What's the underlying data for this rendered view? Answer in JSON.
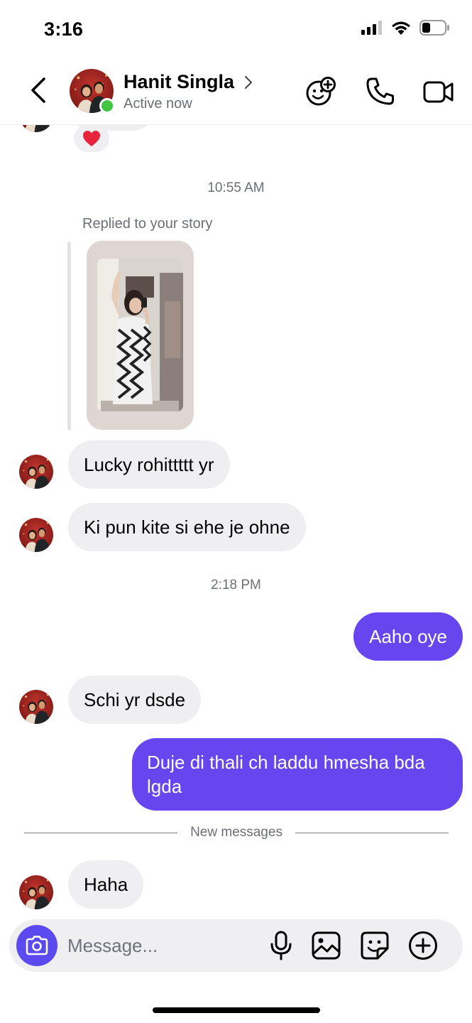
{
  "status_bar": {
    "time": "3:16",
    "icons": [
      "cellular-signal-icon",
      "wifi-icon",
      "battery-icon"
    ]
  },
  "header": {
    "contact_name": "Hanit Singla",
    "contact_status": "Active now",
    "icons": [
      "back-icon",
      "chevron-right-icon",
      "add-effect-icon",
      "phone-icon",
      "video-camera-icon"
    ]
  },
  "thread": {
    "top_reaction": "❤",
    "timestamp_1": "10:55 AM",
    "story_reply_label": "Replied to your story",
    "msg_1": "Lucky rohittttt yr",
    "msg_2": "Ki pun kite si ehe je ohne",
    "timestamp_2": "2:18 PM",
    "msg_3_out": "Aaho oye",
    "msg_4": "Schi yr dsde",
    "msg_5_out": "Duje di thali ch laddu hmesha bda lgda",
    "new_messages_label": "New messages",
    "msg_6": "Haha"
  },
  "composer": {
    "placeholder": "Message...",
    "icons": [
      "camera-icon",
      "microphone-icon",
      "gallery-icon",
      "sticker-icon",
      "plus-icon"
    ]
  },
  "colors": {
    "outgoing_bubble": "#6746ef",
    "incoming_bubble": "#efeff2",
    "online_dot": "#3fc542",
    "camera_button": "#5b4af0"
  }
}
